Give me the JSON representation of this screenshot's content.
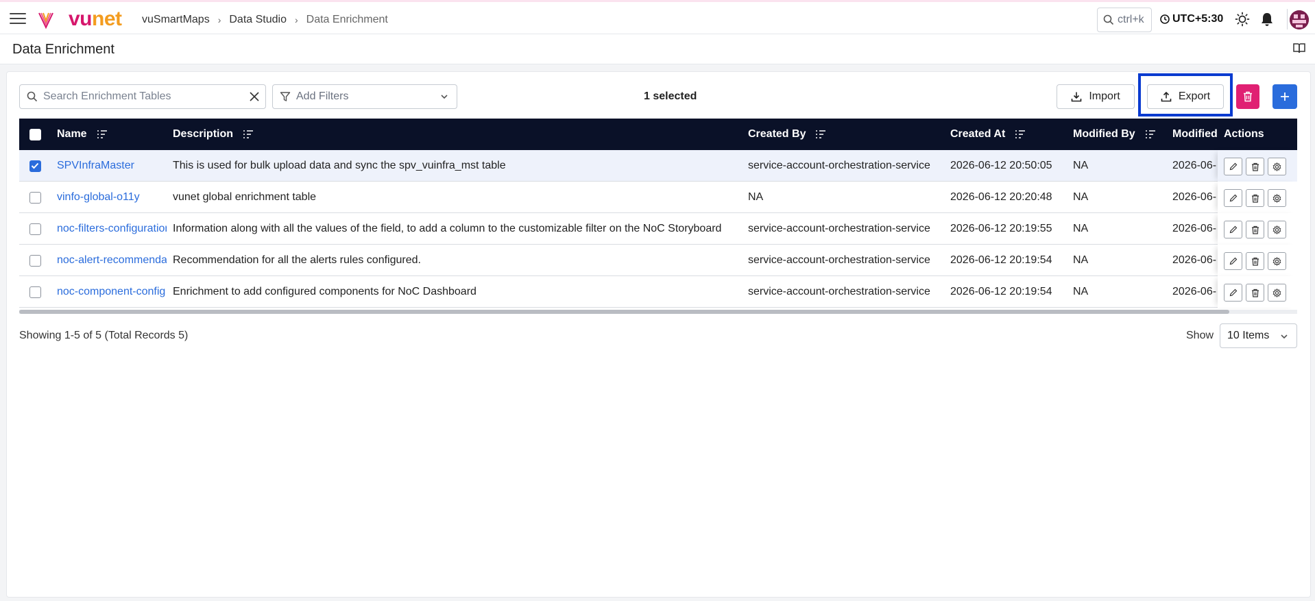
{
  "app": {
    "brand_left": "vu",
    "brand_right": "net",
    "breadcrumb": [
      "vuSmartMaps",
      "Data Studio",
      "Data Enrichment"
    ],
    "search_shortcut": "ctrl+k",
    "timezone": "UTC+5:30"
  },
  "page": {
    "title": "Data Enrichment"
  },
  "toolbar": {
    "search_placeholder": "Search Enrichment Tables",
    "filter_placeholder": "Add Filters",
    "selected_text": "1 selected",
    "import_label": "Import",
    "export_label": "Export"
  },
  "table": {
    "columns": [
      "Name",
      "Description",
      "Created By",
      "Created At",
      "Modified By",
      "Modified",
      "Actions"
    ],
    "rows": [
      {
        "name": "SPVInfraMaster",
        "description": "This is used for bulk upload data and sync the spv_vuinfra_mst table",
        "created_by": "service-account-orchestration-service",
        "created_at": "2026-06-12 20:50:05",
        "modified_by": "NA",
        "modified_at": "2026-06-",
        "checked": true
      },
      {
        "name": "vinfo-global-o11y",
        "description": "vunet global enrichment table",
        "created_by": "NA",
        "created_at": "2026-06-12 20:20:48",
        "modified_by": "NA",
        "modified_at": "2026-06-",
        "checked": false
      },
      {
        "name": "noc-filters-configuration",
        "description": "Information along with all the values of the field, to add a column to the customizable filter on the NoC Storyboard",
        "created_by": "service-account-orchestration-service",
        "created_at": "2026-06-12 20:19:55",
        "modified_by": "NA",
        "modified_at": "2026-06-",
        "checked": false
      },
      {
        "name": "noc-alert-recommendation",
        "description": "Recommendation for all the alerts rules configured.",
        "created_by": "service-account-orchestration-service",
        "created_at": "2026-06-12 20:19:54",
        "modified_by": "NA",
        "modified_at": "2026-06-",
        "checked": false
      },
      {
        "name": "noc-component-config",
        "description": "Enrichment to add configured components for NoC Dashboard",
        "created_by": "service-account-orchestration-service",
        "created_at": "2026-06-12 20:19:54",
        "modified_by": "NA",
        "modified_at": "2026-06-",
        "checked": false
      }
    ]
  },
  "footer": {
    "showing_text": "Showing 1-5 of 5 (Total Records 5)",
    "show_label": "Show",
    "page_size": "10 Items"
  },
  "colors": {
    "brand_pink": "#d6176c",
    "brand_orange": "#f39c1f",
    "header_bg": "#0a1128",
    "link": "#2a6cdc",
    "delete": "#e02073",
    "add": "#2a6cdc",
    "focus_outline": "#0a3bd0"
  }
}
